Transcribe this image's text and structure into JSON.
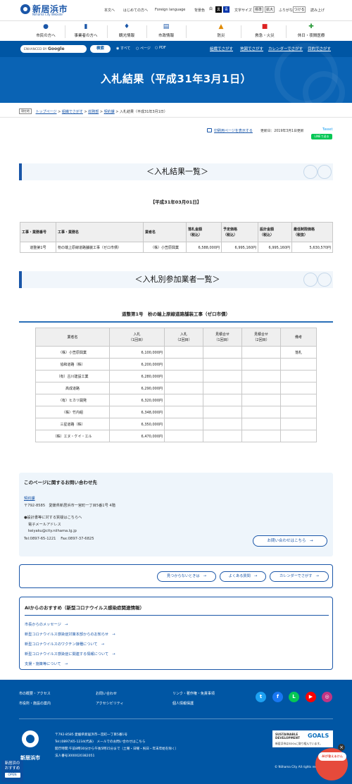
{
  "header": {
    "city_name": "新居浜市",
    "city_sub": "Niihama City Website",
    "top_links": [
      "本文へ",
      "はじめての方へ",
      "Foreign language"
    ],
    "color_label": "背景色",
    "color_options": [
      "白",
      "黒",
      "青"
    ],
    "textsize_label": "文字サイズ",
    "textsize_options": [
      "標準",
      "拡大"
    ],
    "furigana": "ふりがな",
    "furigana_btn": "つける",
    "readaloud": "読み上げ"
  },
  "nav": [
    "市民の方へ",
    "事業者の方へ",
    "観光情報",
    "市政情報",
    "防災",
    "救急・火災",
    "休日・夜間医療"
  ],
  "search": {
    "placeholder_prefix": "ENHANCED BY",
    "placeholder_brand": "Google",
    "button": "検索",
    "options": [
      "すべて",
      "ページ",
      "PDF"
    ],
    "links": [
      "組織でさがす",
      "地図でさがす",
      "カレンダーでさがす",
      "目的でさがす"
    ]
  },
  "page_title": "入札結果（平成31年3月1日）",
  "breadcrumb": {
    "tag": "現在地",
    "items": [
      "トップページ",
      "組織でさがす",
      "総務部",
      "契約課"
    ],
    "current": "入札結果（平成31年3月1日）"
  },
  "page_tools": {
    "print": "印刷用ページを表示する",
    "updated": "更新日：2019年3月1日更新",
    "tweet": "Tweet",
    "line": "LINEで送る"
  },
  "section1": {
    "heading": "＜入札結果一覧＞",
    "date": "【平成31年03月01日】",
    "columns": [
      "工事・業務番号",
      "工事・業務名",
      "業者名",
      "落札金額\n（税込）",
      "予定価格\n（税込）",
      "設計金額\n（税込）",
      "最低制限価格\n（税抜）"
    ],
    "rows": [
      [
        "道整第1号",
        "枌の端上原線道路舗装工事（ゼロ市債）",
        "（株）小笠原興業",
        "6,588,000円",
        "6,995,160円",
        "6,995,160円",
        "5,630,570円"
      ]
    ]
  },
  "section2": {
    "heading": "＜入札別参加業者一覧＞",
    "subtitle": "道整第1号　枌の端上原線道路舗装工事（ゼロ市債）",
    "columns": [
      "業者名",
      "入札\n（1回目）",
      "入札\n（2回目）",
      "見積合せ\n（1回目）",
      "見積合せ\n（2回目）",
      "備考"
    ],
    "rows": [
      [
        "（株）小笠原興業",
        "6,100,000円",
        "",
        "",
        "",
        "落札"
      ],
      [
        "協和道路（株）",
        "6,200,000円",
        "",
        "",
        "",
        ""
      ],
      [
        "（有）古川建設工業",
        "6,280,000円",
        "",
        "",
        "",
        ""
      ],
      [
        "高成道路",
        "6,290,000円",
        "",
        "",
        "",
        ""
      ],
      [
        "（有）ヒカリ開発",
        "6,320,000円",
        "",
        "",
        "",
        ""
      ],
      [
        "（株）竹内組",
        "6,348,000円",
        "",
        "",
        "",
        ""
      ],
      [
        "三星道路（株）",
        "6,350,000円",
        "",
        "",
        "",
        ""
      ],
      [
        "（株）エヌ・ケイ・エル",
        "6,470,000円",
        "",
        "",
        "",
        ""
      ]
    ]
  },
  "contact": {
    "heading": "このページに関するお問い合わせ先",
    "dept": "契約課",
    "address": "〒792-8585　愛媛県新居浜市一宮町一丁目5番1号 4階",
    "note": "●設計書等に対する質疑はこちらへ",
    "email_label": "電子メールアドレス",
    "email": "keiyaku@city.niihama.lg.jp",
    "tel": "Tel:0897-65-1221　 Fax:0897-37-6825",
    "button": "お問い合わせはこちら　→"
  },
  "helper_links": [
    "見つからないときは　→",
    "よくある質問　→",
    "カレンダーでさがす　→"
  ],
  "ai": {
    "heading": "AIからのおすすめ（新型コロナウイルス感染症関連情報）",
    "items": [
      "市長からのメッセージ　→",
      "新型コロナウイルス感染症対策本部からのお知らせ　→",
      "新型コロナウイルスのワクチン接種について　→",
      "新型コロナウイルス感染症に関連する情報について　→",
      "支援・施策等について　→"
    ]
  },
  "footer": {
    "links": [
      "市の概要・アクセス",
      "お問い合わせ",
      "リンク・著作権・免責事項",
      "市役所・施設の案内",
      "アクセシビリティ",
      "個人情報保護"
    ],
    "social": [
      "t",
      "f",
      "L",
      "▶",
      "◎"
    ],
    "social_colors": [
      "#1da1f2",
      "#1877f2",
      "#06c755",
      "#ff0000",
      "#c13584"
    ],
    "city": "新居浜市",
    "address_lines": [
      "〒792-8585 愛媛県新居浜市一宮町一丁目5番1号",
      "Tel:(0897)65-1234(代表)　メールでのお問い合わせはこちら",
      "開庁時間:午前8時30分から午後5時15分まで（土曜・日曜・祝日・年末年始を除く）",
      "法人番号3000020382051"
    ],
    "sdgs_a": "SUSTAINABLE\nDEVELOPMENT",
    "sdgs_b": "GOALS",
    "sdgs_c": "新居浜市はSDGsに取り組んでいます。",
    "copyright": "© Niihama City All rights reserved."
  },
  "recommend": {
    "label": "新居浜の\nおすすめ",
    "open": "OPEN"
  },
  "mascot": {
    "bubble": "AIが答えるけん",
    "close": "×"
  }
}
